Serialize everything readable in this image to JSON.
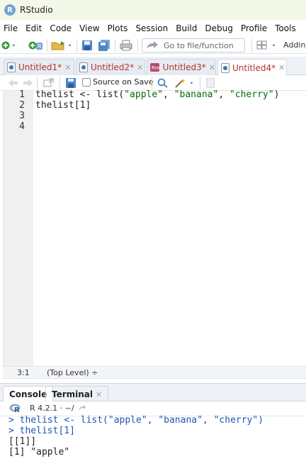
{
  "window": {
    "title": "RStudio",
    "logo_letter": "R"
  },
  "menu": [
    "File",
    "Edit",
    "Code",
    "View",
    "Plots",
    "Session",
    "Build",
    "Debug",
    "Profile",
    "Tools"
  ],
  "toolbar": {
    "goto_placeholder": "Go to file/function",
    "addins_label": "Addins"
  },
  "tabs": [
    {
      "label": "Untitled1*",
      "active": false
    },
    {
      "label": "Untitled2*",
      "active": false
    },
    {
      "label": "Untitled3*",
      "active": false
    },
    {
      "label": "Untitled4*",
      "active": true
    }
  ],
  "editor_toolbar": {
    "source_on_save": "Source on Save",
    "source_on_save_checked": false
  },
  "editor": {
    "lines": [
      {
        "num": "1",
        "text": "thelist <- list(\"apple\", \"banana\", \"cherry\")"
      },
      {
        "num": "2",
        "text": "thelist[1]"
      },
      {
        "num": "3",
        "text": ""
      },
      {
        "num": "4",
        "text": ""
      }
    ]
  },
  "status": {
    "position": "3:1",
    "scope": "(Top Level) ÷"
  },
  "pane": {
    "tabs": [
      "Console",
      "Terminal"
    ],
    "active": "Console"
  },
  "console": {
    "r_version": "R 4.2.1 · ~/",
    "lines": [
      {
        "kind": "in",
        "text": "> thelist <- list(\"apple\", \"banana\", \"cherry\")"
      },
      {
        "kind": "in",
        "text": "> thelist[1]"
      },
      {
        "kind": "out",
        "text": "[[1]]"
      },
      {
        "kind": "out",
        "text": "[1] \"apple\""
      }
    ]
  },
  "colors": {
    "titlebar_bg": "#f3f8e9",
    "tab_label": "#b3322e",
    "console_input": "#1f55b7",
    "string": "#036a07"
  }
}
